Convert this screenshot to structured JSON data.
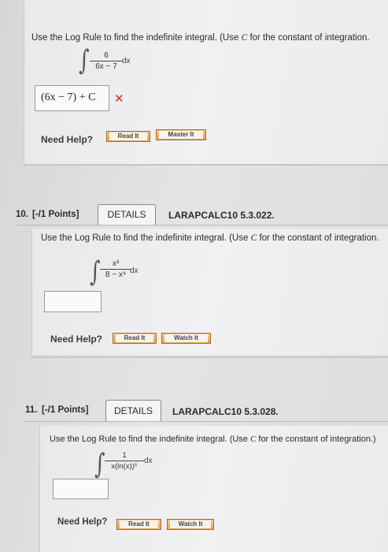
{
  "q9": {
    "instruction_pre": "Use the Log Rule to find the indefinite integral. (Use ",
    "instruction_var": "C",
    "instruction_post": " for the constant of integration.",
    "integrand_num": "6",
    "integrand_den": "6x − 7",
    "dx": "dx",
    "answer": "(6x − 7) + C",
    "need_help": "Need Help?",
    "read_label": "Read It",
    "second_label": "Master It"
  },
  "q10": {
    "number": "10.",
    "points": "[-/1 Points]",
    "details": "DETAILS",
    "code": "LARAPCALC10 5.3.022.",
    "instruction_pre": "Use the Log Rule to find the indefinite integral. (Use ",
    "instruction_var": "C",
    "instruction_post": " for the constant of integration.",
    "integrand_num": "x³",
    "integrand_den": "8 − x⁴",
    "dx": "dx",
    "answer": "",
    "need_help": "Need Help?",
    "read_label": "Read It",
    "second_label": "Watch It"
  },
  "q11": {
    "number": "11.",
    "points": "[-/1 Points]",
    "details": "DETAILS",
    "code": "LARAPCALC10 5.3.028.",
    "instruction_pre": "Use the Log Rule to find the indefinite integral. (Use ",
    "instruction_var": "C",
    "instruction_post": " for the constant of integration.)",
    "integrand_num": "1",
    "integrand_den": "x(ln(x))⁵",
    "dx": "dx",
    "answer": "",
    "need_help": "Need Help?",
    "read_label": "Read It",
    "second_label": "Watch It"
  }
}
